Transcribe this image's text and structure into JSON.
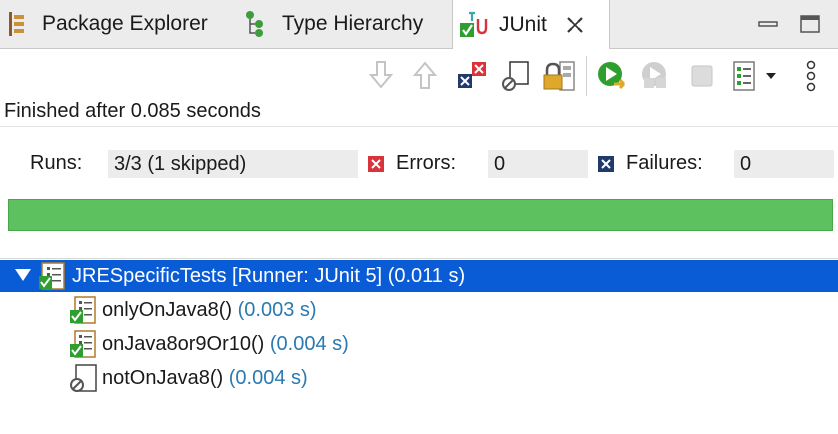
{
  "tabs": [
    {
      "label": "Package Explorer",
      "icon": "package-explorer-icon"
    },
    {
      "label": "Type Hierarchy",
      "icon": "type-hierarchy-icon"
    },
    {
      "label": "JUnit",
      "icon": "junit-icon",
      "active": true,
      "closable": true
    }
  ],
  "toolbar": {
    "buttons": [
      "next-failure-icon",
      "previous-failure-icon",
      "show-failures-only-icon",
      "show-skipped-only-icon",
      "scroll-lock-icon",
      "rerun-test-icon",
      "rerun-failed-first-icon",
      "stop-icon",
      "test-run-history-icon",
      "view-menu-icon"
    ]
  },
  "status_text": "Finished after 0.085 seconds",
  "counters": {
    "runs_label": "Runs:",
    "runs_value": "3/3 (1 skipped)",
    "errors_label": "Errors:",
    "errors_value": "0",
    "failures_label": "Failures:",
    "failures_value": "0"
  },
  "progress": {
    "fraction": 1.0,
    "color": "#5ec15f"
  },
  "tree": {
    "root": {
      "name": "JRESpecificTests [Runner: JUnit 5]",
      "time": "(0.011 s)",
      "expanded": true,
      "selected": true
    },
    "children": [
      {
        "name": "onlyOnJava8()",
        "time": "(0.003 s)",
        "status": "passed"
      },
      {
        "name": "onJava8or9Or10()",
        "time": "(0.004 s)",
        "status": "passed"
      },
      {
        "name": "notOnJava8()",
        "time": "(0.004 s)",
        "status": "skipped"
      }
    ]
  },
  "colors": {
    "selection": "#0a5cd6",
    "time": "#2a7ab0",
    "pass": "#2e9e2e",
    "error": "#d9343b",
    "failure": "#1f3a6b"
  }
}
